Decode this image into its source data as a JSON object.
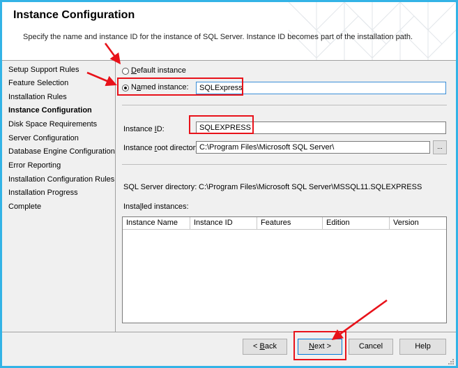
{
  "header": {
    "title": "Instance Configuration",
    "description": "Specify the name and instance ID for the instance of SQL Server. Instance ID becomes part of the installation path."
  },
  "nav": {
    "items": [
      {
        "label": "Setup Support Rules"
      },
      {
        "label": "Feature Selection"
      },
      {
        "label": "Installation Rules"
      },
      {
        "label": "Instance Configuration",
        "active": true
      },
      {
        "label": "Disk Space Requirements"
      },
      {
        "label": "Server Configuration"
      },
      {
        "label": "Database Engine Configuration"
      },
      {
        "label": "Error Reporting"
      },
      {
        "label": "Installation Configuration Rules"
      },
      {
        "label": "Installation Progress"
      },
      {
        "label": "Complete"
      }
    ]
  },
  "instance": {
    "default_label_mnemonic": "D",
    "default_label_rest": "efault instance",
    "default_selected": false,
    "named_label_pre": "N",
    "named_label_mnemonic": "a",
    "named_label_rest": "med instance:",
    "named_selected": true,
    "named_value": "SQLExpress",
    "id_label_pre": "Instance ",
    "id_label_mnemonic": "I",
    "id_label_rest": "D:",
    "id_value": "SQLEXPRESS",
    "root_label_pre": "Instance ",
    "root_label_mnemonic": "r",
    "root_label_rest": "oot directory:",
    "root_value": "C:\\Program Files\\Microsoft SQL Server\\",
    "browse_label": "...",
    "sql_dir_label": "SQL Server directory:",
    "sql_dir_value": "C:\\Program Files\\Microsoft SQL Server\\MSSQL11.SQLEXPRESS",
    "installed_label_pre": "Insta",
    "installed_label_mnemonic": "l",
    "installed_label_rest": "led instances:"
  },
  "grid": {
    "columns": [
      "Instance Name",
      "Instance ID",
      "Features",
      "Edition",
      "Version"
    ],
    "rows": []
  },
  "footer": {
    "back_pre": "< ",
    "back_mnemonic": "B",
    "back_rest": "ack",
    "next_mnemonic": "N",
    "next_rest": "ext >",
    "cancel": "Cancel",
    "help": "Help"
  },
  "colors": {
    "frame_border": "#33b3e6",
    "annotation_red": "#e8121a",
    "window_bg": "#f0f0f0"
  }
}
